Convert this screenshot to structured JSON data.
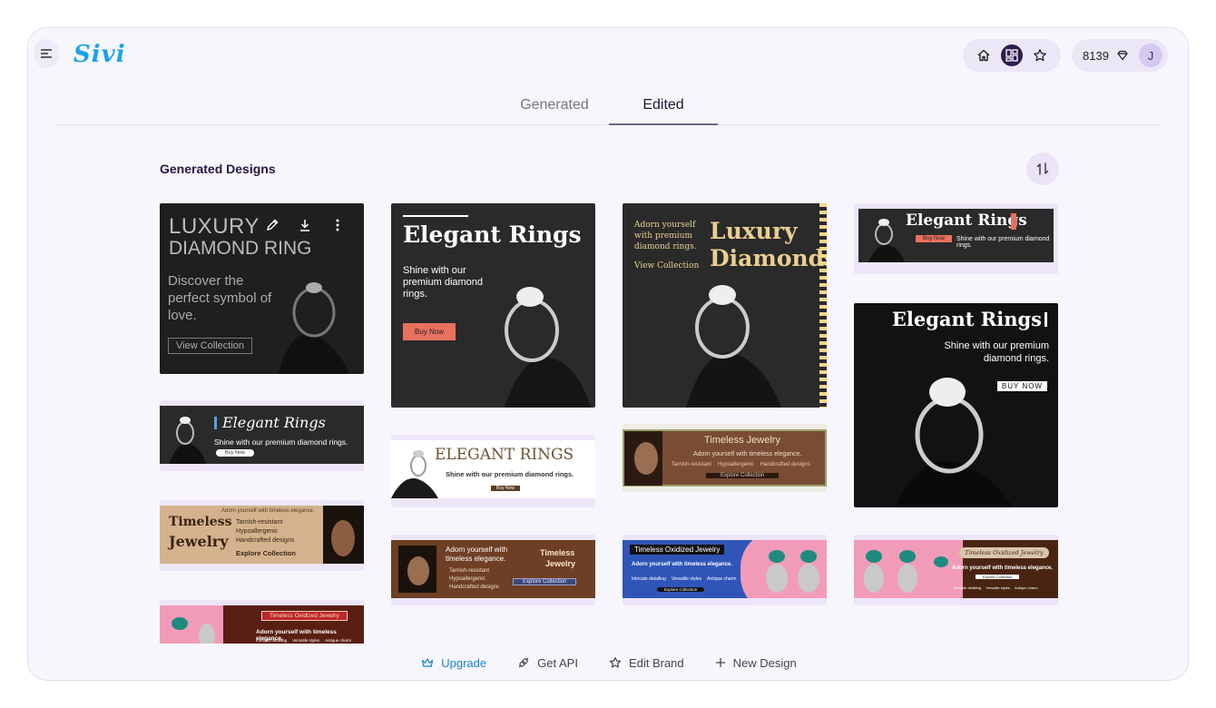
{
  "app": {
    "logo": "Sivi",
    "credits": "8139",
    "avatar_initial": "J"
  },
  "tabs": [
    {
      "label": "Generated"
    },
    {
      "label": "Edited"
    }
  ],
  "section": {
    "title": "Generated Designs"
  },
  "cards": {
    "c1": {
      "title1": "LUXURY",
      "title2": "DIAMOND RING",
      "body": "Discover the perfect symbol of love.",
      "cta": "View Collection"
    },
    "c2": {
      "title": "Elegant Rings",
      "body": "Shine with our premium diamond rings.",
      "cta": "Buy Now"
    },
    "c3": {
      "tag": "Adorn yourself with premium diamond rings.",
      "title1": "Luxury",
      "title2": "Diamonds",
      "cta": "View Collection"
    },
    "c4": {
      "title": "Elegant Rings",
      "cta": "Buy Now",
      "body": "Shine with our premium diamond rings."
    },
    "c5": {
      "title": "Elegant Rings",
      "body": "Shine with our premium diamond rings.",
      "cta": "Buy Now"
    },
    "c6": {
      "title": "ELEGANT RINGS",
      "body": "Shine with our premium diamond rings.",
      "cta": "Buy Now"
    },
    "c7": {
      "title": "Timeless Jewelry",
      "body": "Adorn yourself with timeless elegance.",
      "features": [
        "Tarnish-resistant",
        "Hypoallergenic",
        "Handcrafted designs"
      ],
      "cta": "Explore Collection"
    },
    "c8": {
      "title": "Elegant Rings",
      "body": "Shine with our premium diamond rings.",
      "cta": "BUY NOW"
    },
    "c9": {
      "title1": "Timeless",
      "title2": "Jewelry",
      "tag": "Adorn yourself with timeless elegance.",
      "features": [
        "Tarnish-resistant",
        "Hypoallergenic",
        "Handcrafted designs"
      ],
      "cta": "Explore Collection"
    },
    "c10": {
      "body": "Adorn yourself with timeless elegance.",
      "features": [
        "Tarnish-resistant",
        "Hypoallergenic",
        "Handcrafted designs"
      ],
      "title1": "Timeless",
      "title2": "Jewelry",
      "cta": "Explore Collection"
    },
    "c11": {
      "title": "Timeless Oxidized Jewelry",
      "body": "Adorn yourself with timeless elegance.",
      "features": [
        "Intricate detailing",
        "Versatile styles",
        "Antique charm"
      ],
      "cta": "Explore Collection"
    },
    "c12": {
      "title": "Timeless Oxidized Jewelry",
      "body": "Adorn yourself with timeless elegance.",
      "features": [
        "Intricate detailing",
        "Versatile styles",
        "Antique charm"
      ],
      "cta": "Explore Collection"
    },
    "c13": {
      "title": "Timeless Oxidized Jewelry",
      "body": "Adorn yourself with timeless elegance.",
      "features": [
        "Intricate detailing",
        "Versatile styles",
        "Antique charm"
      ]
    }
  },
  "bottom": {
    "upgrade": "Upgrade",
    "api": "Get API",
    "brand": "Edit Brand",
    "new": "New Design"
  },
  "colors": {
    "accent": "#1aa3e8",
    "dark": "#2b1d4e",
    "coral": "#e8705e",
    "brown": "#5c3a24",
    "pink": "#f29bb8",
    "blue": "#2f55b8"
  }
}
